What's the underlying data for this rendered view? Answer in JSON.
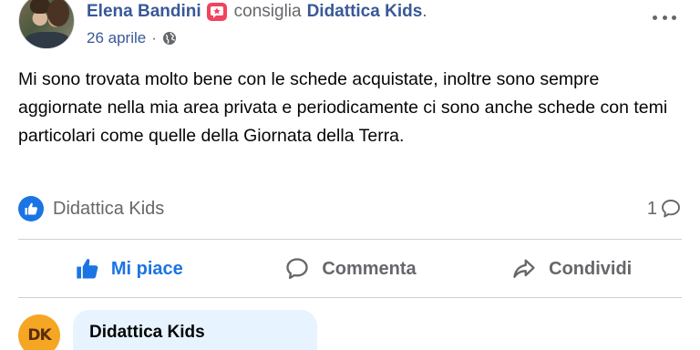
{
  "post": {
    "author": "Elena Bandini",
    "recommend_text": "consiglia",
    "page_name": "Didattica Kids",
    "trailing_dot": ".",
    "date": "26 aprile",
    "separator": "·",
    "privacy_icon": "globe-icon",
    "body": "Mi sono trovata molto bene con le schede acquistate, inoltre sono sempre aggiornate nella mia area privata e periodicamente ci sono anche schede con temi particolari come quelle della Giornata della Terra."
  },
  "reactions": {
    "icon": "like-icon",
    "names": "Didattica Kids",
    "comment_count": "1"
  },
  "actions": {
    "like_label": "Mi piace",
    "comment_label": "Commenta",
    "share_label": "Condividi"
  },
  "comment": {
    "avatar_text": "DK",
    "author": "Didattica Kids"
  },
  "colors": {
    "link_blue": "#385898",
    "like_blue": "#1b74e4",
    "muted": "#65676b",
    "badge_red": "#f3425f",
    "comment_bubble": "#e7f3ff",
    "page_avatar": "#f5a623"
  }
}
